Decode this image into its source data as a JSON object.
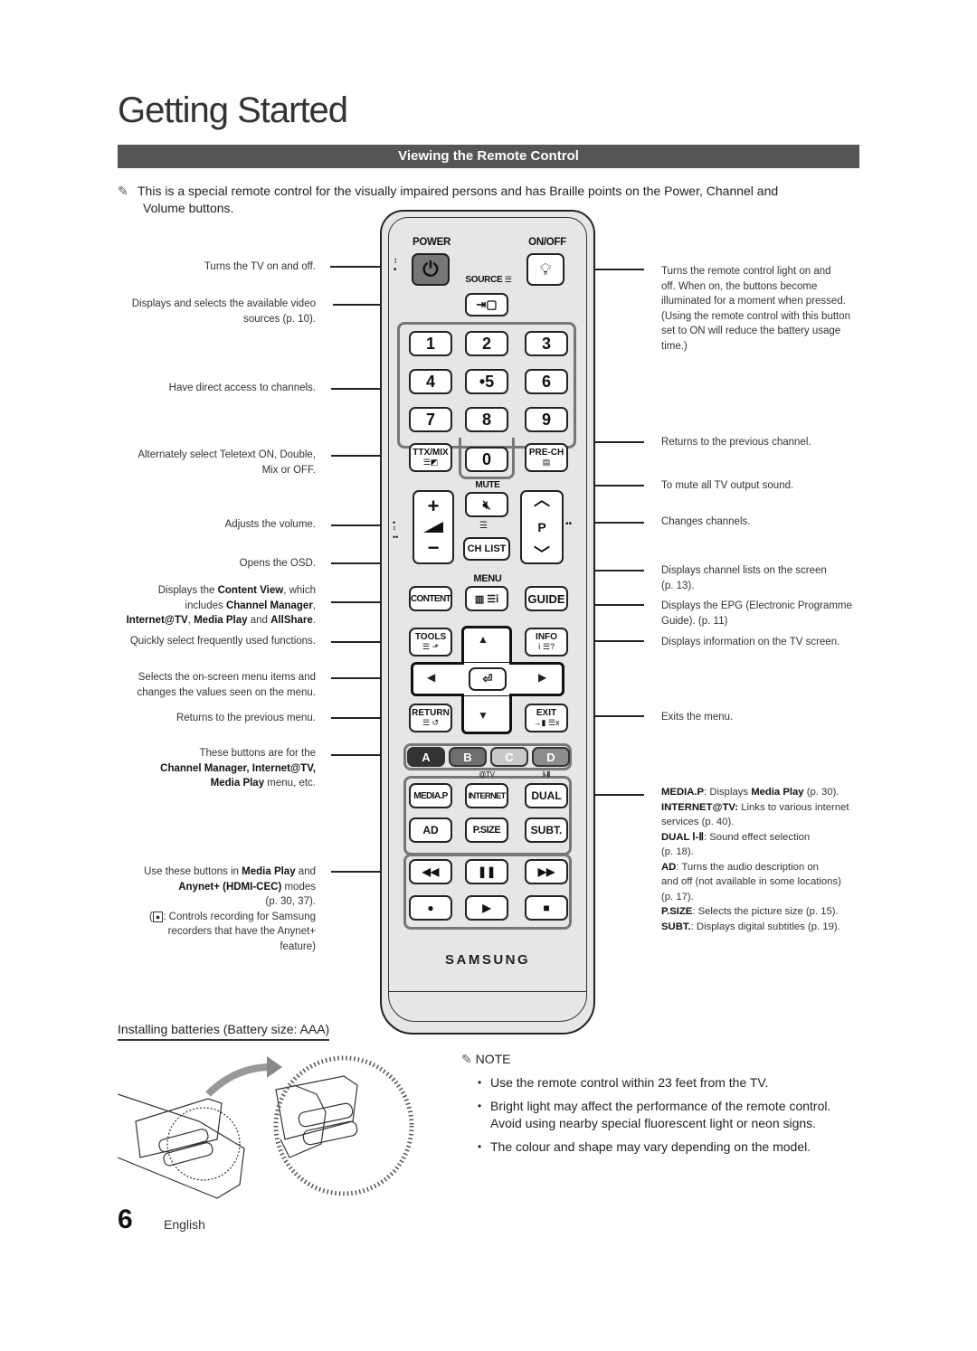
{
  "page": {
    "title": "Getting Started",
    "section_title": "Viewing the Remote Control",
    "intro_line1": "This is a special remote control for the visually impaired persons and has Braille points on the Power, Channel and",
    "intro_line2": "Volume buttons.",
    "page_number": "6",
    "language": "English"
  },
  "left_annotations": [
    {
      "id": "power",
      "text": "Turns the TV on and off."
    },
    {
      "id": "source",
      "line1": "Displays and selects the available video",
      "line2": "sources (p. 10)."
    },
    {
      "id": "numbers",
      "text": "Have direct access to channels."
    },
    {
      "id": "ttx",
      "line1": "Alternately select Teletext ON, Double,",
      "line2": "Mix or OFF."
    },
    {
      "id": "volume",
      "text": "Adjusts the volume."
    },
    {
      "id": "menu",
      "text": "Opens the OSD."
    },
    {
      "id": "content",
      "l1a": "Displays the ",
      "l1b": "Content View",
      "l1c": ", which",
      "l2a": "includes ",
      "l2b": "Channel Manager",
      "l2c": ",",
      "l3a": "Internet@TV",
      "l3b": ", ",
      "l3c": "Media Play",
      "l3d": " and ",
      "l3e": "AllShare",
      "l3f": "."
    },
    {
      "id": "tools",
      "text": "Quickly select frequently used functions."
    },
    {
      "id": "nav",
      "line1": "Selects the on-screen menu items and",
      "line2": "changes the values seen on the menu."
    },
    {
      "id": "return",
      "text": "Returns to the previous menu."
    },
    {
      "id": "colors",
      "line1": "These buttons are for the",
      "line2": "Channel Manager, Internet@TV,",
      "line3a": "Media Play",
      "line3b": " menu, etc."
    },
    {
      "id": "playback",
      "l1a": "Use these buttons in ",
      "l1b": "Media Play",
      "l1c": " and",
      "l2a": "Anynet+ (HDMI-CEC)",
      "l2b": " modes",
      "l3": "(p. 30, 37).",
      "l4a": "(",
      "l4b": "●",
      "l4c": ": Controls recording for Samsung",
      "l5": "recorders that have the Anynet+",
      "l6": "feature)"
    }
  ],
  "right_annotations": [
    {
      "id": "onoff",
      "lines": [
        "Turns the remote control light on and",
        "off. When on, the buttons become",
        "illuminated for a moment when pressed.",
        "(Using the remote control with this button",
        "set to ON will reduce the battery usage",
        "time.)"
      ]
    },
    {
      "id": "prech",
      "text": "Returns to the previous channel."
    },
    {
      "id": "mute",
      "text": "To mute all TV output sound."
    },
    {
      "id": "channel",
      "text": "Changes channels."
    },
    {
      "id": "chlist",
      "line1": "Displays channel lists on the screen",
      "line2": "(p. 13)."
    },
    {
      "id": "guide",
      "line1": "Displays the EPG (Electronic Programme",
      "line2": "Guide). (p. 11)"
    },
    {
      "id": "info",
      "text": "Displays information on the TV screen."
    },
    {
      "id": "exit",
      "text": "Exits the menu."
    },
    {
      "id": "functions",
      "l1a": "MEDIA.P",
      "l1b": ": Displays ",
      "l1c": "Media Play",
      "l1d": " (p. 30).",
      "l2a": "INTERNET@TV:",
      "l2b": " Links to various internet",
      "l3": "services (p. 40).",
      "l4a": "DUAL Ⅰ-Ⅱ",
      "l4b": ": Sound effect selection",
      "l5": "(p. 18).",
      "l6a": "AD",
      "l6b": ": Turns the audio description on",
      "l7": "and off (not available in some locations)",
      "l8": "(p. 17).",
      "l9a": "P.SIZE",
      "l9b": ": Selects the picture size (p. 15).",
      "l10a": "SUBT.",
      "l10b": ": Displays digital subtitles (p. 19)."
    }
  ],
  "remote": {
    "power_label": "POWER",
    "onoff_label": "ON/OFF",
    "source_label": "SOURCE",
    "number_keys": [
      "1",
      "2",
      "3",
      "4",
      "•5",
      "6",
      "7",
      "8",
      "9",
      "0"
    ],
    "ttx_label": "TTX/MIX",
    "prech_label": "PRE-CH",
    "mute_label": "MUTE",
    "vol_plus": "+",
    "vol_minus": "−",
    "ch_label": "P",
    "chlist_label": "CH LIST",
    "menu_label": "MENU",
    "content_label": "CONTENT",
    "guide_label": "GUIDE",
    "tools_label": "TOOLS",
    "info_label": "INFO",
    "return_label": "RETURN",
    "exit_label": "EXIT",
    "color_keys": [
      {
        "label": "A",
        "color": "#333333"
      },
      {
        "label": "B",
        "color": "#6e6e6e"
      },
      {
        "label": "C",
        "color": "#c8c8c8"
      },
      {
        "label": "D",
        "color": "#8c8c8c"
      }
    ],
    "internet_caption": "@TV",
    "dual_caption": "Ⅰ-Ⅱ",
    "mediap_label": "MEDIA.P",
    "internet_label": "INTERNET",
    "dual_label": "DUAL",
    "ad_label": "AD",
    "psize_label": "P.SIZE",
    "subt_label": "SUBT.",
    "playback_keys": [
      "◀◀",
      "❚❚",
      "▶▶",
      "●",
      "▶",
      "■"
    ],
    "brand": "SAMSUNG"
  },
  "batteries": {
    "heading": "Installing batteries (Battery size: AAA)"
  },
  "note": {
    "title": "NOTE",
    "items": [
      "Use the remote control within 23 feet from the TV.",
      "Bright light may affect the performance of the remote control. Avoid using nearby special fluorescent light or neon signs.",
      "The colour and shape may vary depending on the model."
    ]
  }
}
